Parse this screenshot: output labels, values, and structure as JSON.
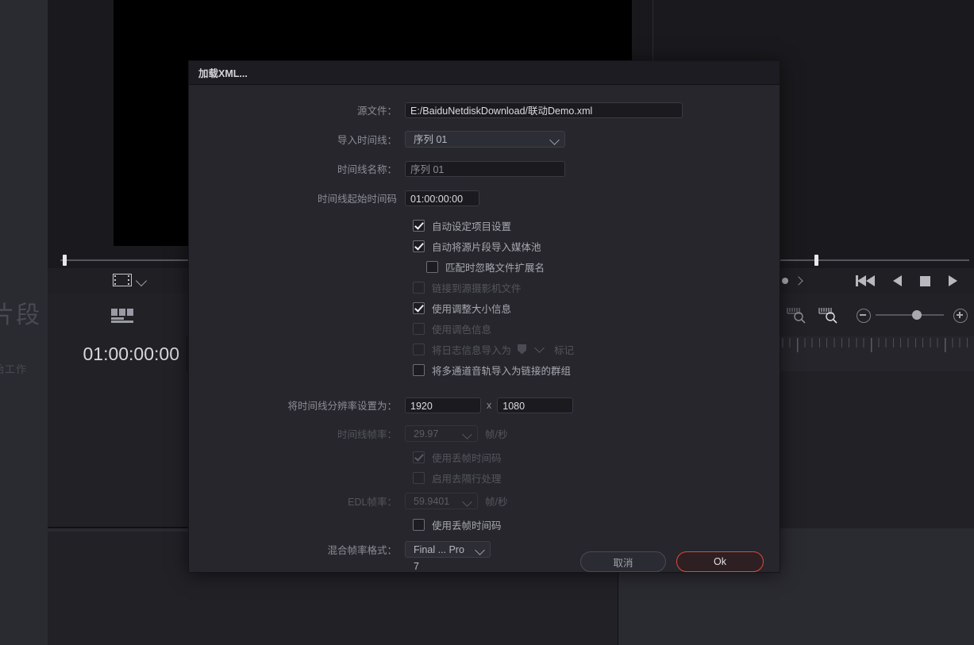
{
  "background": {
    "left_rail": {
      "text_big": "片段",
      "text_small": "始工作"
    },
    "viewer_timecode": "01:00:00:00",
    "icons": {
      "filmstrip": "filmstrip-icon",
      "chevron_down": "chevron-down-icon",
      "chevron_left": "chevron-left-icon",
      "clip_strip": "clip-strip-icon",
      "mark_in": "chevron-left-icon",
      "mark_dot": "record-dot-icon",
      "mark_out": "chevron-right-icon",
      "jump_start": "skip-to-start-icon",
      "play_reverse": "play-reverse-icon",
      "stop": "stop-icon",
      "play": "play-icon",
      "fast_forward": "fast-forward-icon",
      "zoom_fit": "zoom-fit-ruler-icon",
      "zoom_full": "zoom-full-ruler-icon",
      "zoom_out": "zoom-out-icon",
      "zoom_in": "zoom-in-icon"
    }
  },
  "dialog": {
    "title": "加载XML...",
    "fields": {
      "source_file_label": "源文件：",
      "source_file_value": "E:/BaiduNetdiskDownload/联动Demo.xml",
      "import_timeline_label": "导入时间线：",
      "import_timeline_value": "序列 01",
      "timeline_name_label": "时间线名称：",
      "timeline_name_value": "序列 01",
      "timeline_start_tc_label": "时间线起始时间码",
      "timeline_start_tc_value": "01:00:00:00",
      "resolution_label": "将时间线分辨率设置为：",
      "resolution_width": "1920",
      "resolution_x": "x",
      "resolution_height": "1080",
      "timeline_framerate_label": "时间线帧率：",
      "timeline_framerate_value": "29.97",
      "timeline_framerate_unit": "帧/秒",
      "edl_framerate_label": "EDL帧率：",
      "edl_framerate_value": "59.9401",
      "edl_framerate_unit": "帧/秒",
      "mixed_framerate_label": "混合帧率格式：",
      "mixed_framerate_value": "Final ... Pro 7"
    },
    "checkboxes": [
      {
        "id": "auto-project-settings",
        "label": "自动设定项目设置",
        "checked": true,
        "disabled": false,
        "indent": 0
      },
      {
        "id": "auto-import-clips",
        "label": "自动将源片段导入媒体池",
        "checked": true,
        "disabled": false,
        "indent": 0
      },
      {
        "id": "ignore-file-extensions",
        "label": "匹配时忽略文件扩展名",
        "checked": false,
        "disabled": false,
        "indent": 1
      },
      {
        "id": "link-camera-files",
        "label": "链接到源摄影机文件",
        "checked": false,
        "disabled": true,
        "indent": 0
      },
      {
        "id": "use-sizing-info",
        "label": "使用调整大小信息",
        "checked": true,
        "disabled": false,
        "indent": 0
      },
      {
        "id": "use-color-info",
        "label": "使用调色信息",
        "checked": false,
        "disabled": true,
        "indent": 0
      },
      {
        "id": "import-log-as-marker",
        "label": "将日志信息导入为",
        "checked": false,
        "disabled": true,
        "indent": 0,
        "suffix": "标记",
        "has_marker_picker": true
      },
      {
        "id": "multichannel-linked",
        "label": "将多通道音轨导入为链接的群组",
        "checked": false,
        "disabled": false,
        "indent": 0
      }
    ],
    "framerate_checkboxes": [
      {
        "id": "use-drop-frame-tc-timeline",
        "label": "使用丢帧时间码",
        "checked": true,
        "disabled": true
      },
      {
        "id": "enable-deinterlace",
        "label": "启用去隔行处理",
        "checked": false,
        "disabled": true
      },
      {
        "id": "use-drop-frame-tc-edl",
        "label": "使用丢帧时间码",
        "checked": false,
        "disabled": false
      }
    ],
    "buttons": {
      "cancel": "取消",
      "ok": "Ok"
    },
    "colors": {
      "accent": "#e04a3a",
      "panel": "#26262c",
      "titlebar": "#1c1c22",
      "label": "#8d8d98"
    }
  }
}
